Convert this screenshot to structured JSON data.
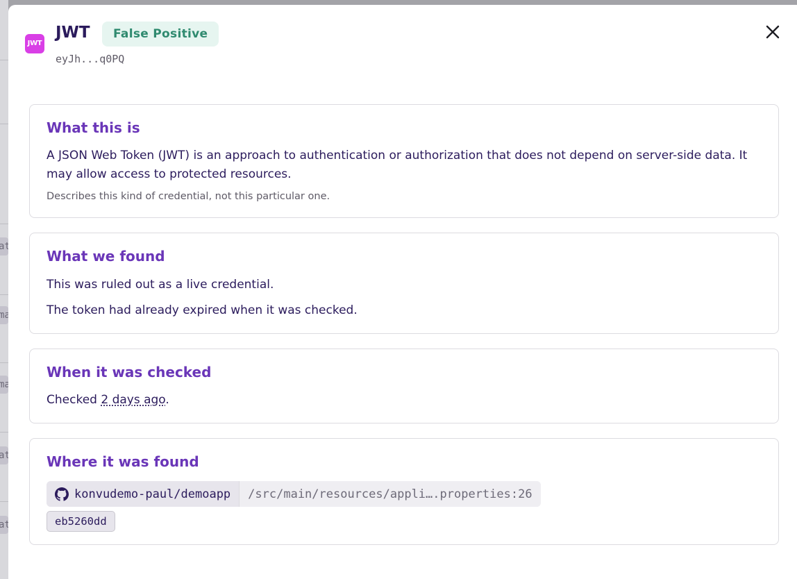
{
  "secret": {
    "type_icon_label": "JWT",
    "title": "JWT",
    "status": "False Positive",
    "token_preview": "eyJh...q0PQ"
  },
  "what_this_is": {
    "heading": "What this is",
    "description": "A JSON Web Token (JWT) is an approach to authentication or authorization that does not depend on server-side data. It may allow access to protected resources.",
    "note": "Describes this kind of credential, not this particular one."
  },
  "what_we_found": {
    "heading": "What we found",
    "line1": "This was ruled out as a live credential.",
    "line2": "The token had already expired when it was checked."
  },
  "when_checked": {
    "heading": "When it was checked",
    "prefix": "Checked ",
    "relative_time": "2 days ago",
    "suffix": "."
  },
  "where_found": {
    "heading": "Where it was found",
    "repo": "konvudemo-paul/demoapp",
    "path": "/src/main/resources/appli….properties:26",
    "commit": "eb5260dd"
  },
  "background": {
    "chips": [
      "at",
      "ma",
      "ma",
      "at",
      "at"
    ]
  },
  "colors": {
    "heading": "#6a36b8",
    "text": "#2b1b5c",
    "status_bg": "#e6f5f0",
    "status_text": "#2f8a6f",
    "jwt_icon": "#d93fe6"
  },
  "icons": {
    "close": "close-icon",
    "repo": "github-icon"
  }
}
